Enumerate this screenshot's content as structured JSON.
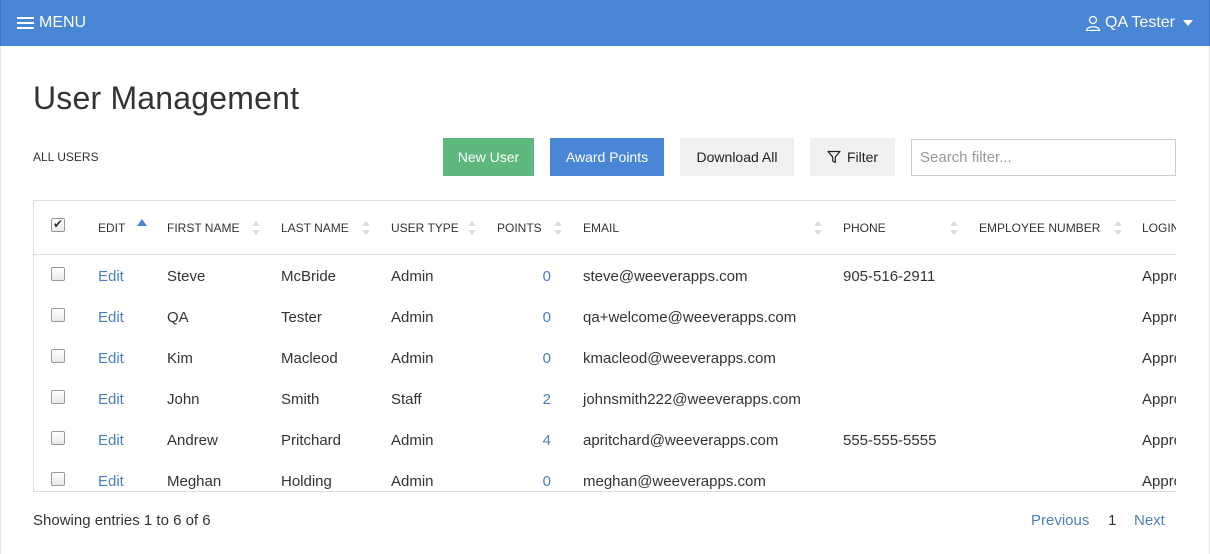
{
  "header": {
    "menu_label": "MENU",
    "user_label": "QA Tester"
  },
  "page": {
    "title": "User Management",
    "section_label": "ALL USERS"
  },
  "toolbar": {
    "new_user": "New User",
    "award_points": "Award Points",
    "download_all": "Download All",
    "filter": "Filter",
    "search_placeholder": "Search filter..."
  },
  "table": {
    "columns": {
      "edit": "EDIT",
      "first_name": "FIRST NAME",
      "last_name": "LAST NAME",
      "user_type": "USER TYPE",
      "points": "POINTS",
      "email": "EMAIL",
      "phone": "PHONE",
      "employee_number": "EMPLOYEE NUMBER",
      "login": "LOGIN"
    },
    "rows": [
      {
        "edit": "Edit",
        "first": "Steve",
        "last": "McBride",
        "type": "Admin",
        "points": "0",
        "email": "steve@weeverapps.com",
        "phone": "905-516-2911",
        "employee": "",
        "login": "Approved"
      },
      {
        "edit": "Edit",
        "first": "QA",
        "last": "Tester",
        "type": "Admin",
        "points": "0",
        "email": "qa+welcome@weeverapps.com",
        "phone": "",
        "employee": "",
        "login": "Approved"
      },
      {
        "edit": "Edit",
        "first": "Kim",
        "last": "Macleod",
        "type": "Admin",
        "points": "0",
        "email": "kmacleod@weeverapps.com",
        "phone": "",
        "employee": "",
        "login": "Approved"
      },
      {
        "edit": "Edit",
        "first": "John",
        "last": "Smith",
        "type": "Staff",
        "points": "2",
        "email": "johnsmith222@weeverapps.com",
        "phone": "",
        "employee": "",
        "login": "Approved"
      },
      {
        "edit": "Edit",
        "first": "Andrew",
        "last": "Pritchard",
        "type": "Admin",
        "points": "4",
        "email": "apritchard@weeverapps.com",
        "phone": "555-555-5555",
        "employee": "",
        "login": "Approved"
      },
      {
        "edit": "Edit",
        "first": "Meghan",
        "last": "Holding",
        "type": "Admin",
        "points": "0",
        "email": "meghan@weeverapps.com",
        "phone": "",
        "employee": "",
        "login": "Approved"
      }
    ]
  },
  "footer": {
    "info": "Showing entries 1 to 6 of 6",
    "previous": "Previous",
    "current_page": "1",
    "next": "Next"
  },
  "colors": {
    "brand": "#4a86d6",
    "success": "#5cb87d",
    "link": "#4a7fbf"
  }
}
